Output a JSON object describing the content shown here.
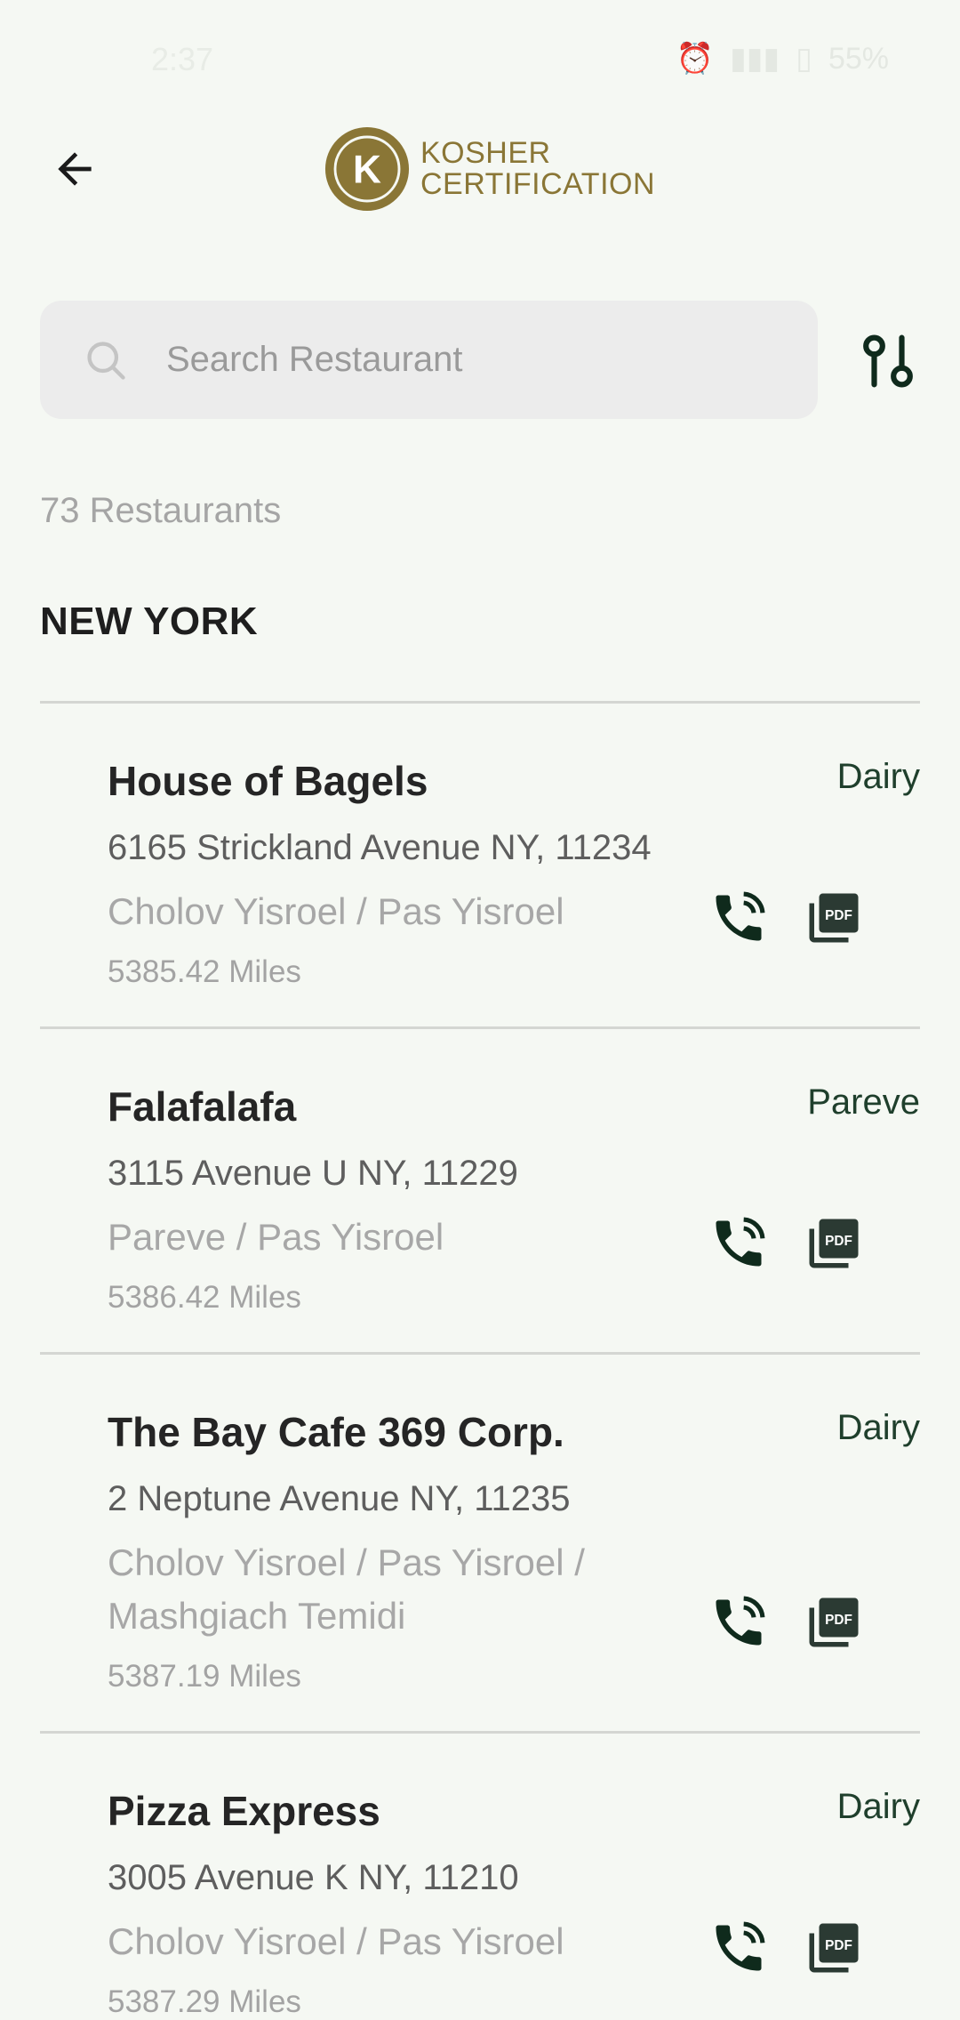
{
  "status_bar": {
    "time": "2:37",
    "battery": "55%"
  },
  "header": {
    "back_icon": "arrow-left-icon",
    "logo_text_line1": "KOSHER",
    "logo_text_line2": "CERTIFICATION",
    "logo_letter": "K",
    "brand_color": "#8a7636"
  },
  "search": {
    "placeholder": "Search Restaurant",
    "value": ""
  },
  "results": {
    "count_label": "73 Restaurants"
  },
  "region": {
    "title": "NEW YORK"
  },
  "restaurants": [
    {
      "name": "House of Bagels",
      "type": "Dairy",
      "address": "6165 Strickland Avenue  NY, 11234",
      "certification": "Cholov Yisroel / Pas Yisroel",
      "distance": "5385.42 Miles"
    },
    {
      "name": "Falafalafa",
      "type": "Pareve",
      "address": "3115 Avenue U  NY, 11229",
      "certification": "Pareve / Pas Yisroel",
      "distance": "5386.42 Miles"
    },
    {
      "name": "The Bay Cafe 369 Corp.",
      "type": "Dairy",
      "address": "2 Neptune Avenue  NY, 11235",
      "certification": "Cholov Yisroel / Pas Yisroel / Mashgiach Temidi",
      "distance": "5387.19 Miles"
    },
    {
      "name": "Pizza Express",
      "type": "Dairy",
      "address": "3005 Avenue K  NY, 11210",
      "certification": "Cholov Yisroel / Pas Yisroel",
      "distance": "5387.29 Miles"
    }
  ],
  "colors": {
    "accent": "#1f3f2c",
    "icon": "#0f2a1c",
    "background": "#f5f8f3"
  }
}
